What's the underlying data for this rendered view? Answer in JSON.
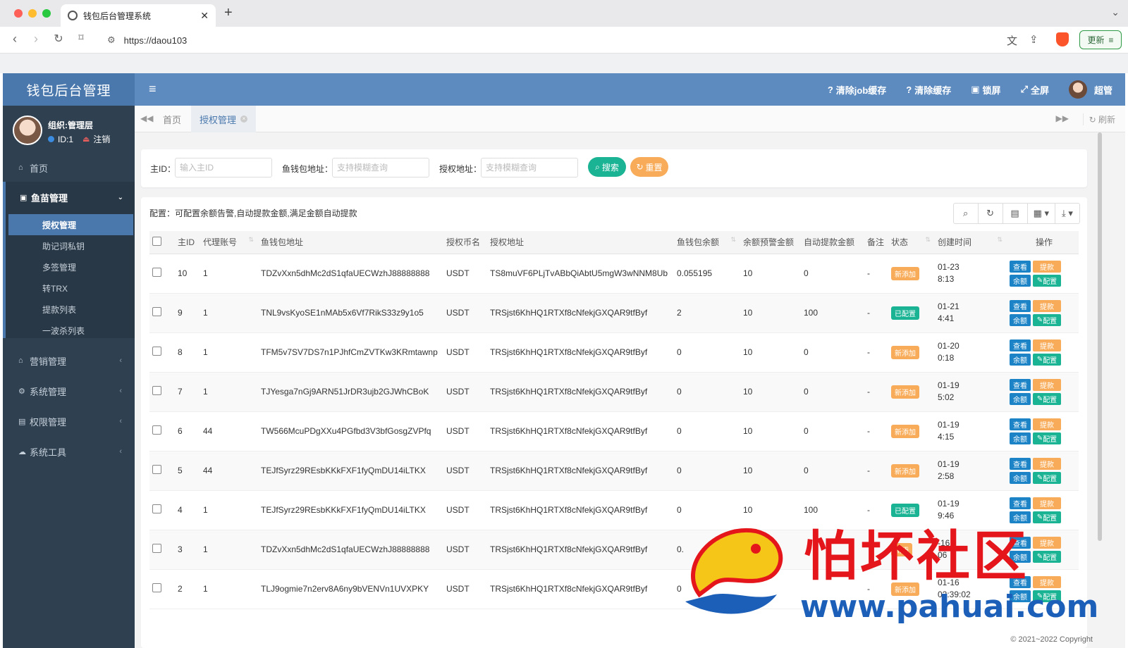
{
  "browser": {
    "tab_title": "钱包后台管理系统",
    "url": "https://daou103",
    "update_label": "更新"
  },
  "app": {
    "logo_text": "钱包后台管理",
    "header_items": [
      "清除job缓存",
      "清除缓存",
      "锁屏",
      "全屏"
    ],
    "username": "超管"
  },
  "user": {
    "org": "组织:管理层",
    "id": "ID:1",
    "logout": "注销"
  },
  "sidebar": {
    "home": "首页",
    "group": "鱼苗管理",
    "sub_items": [
      "授权管理",
      "助记词私钥",
      "多签管理",
      "转TRX",
      "提款列表",
      "一波杀列表"
    ],
    "items": [
      "营销管理",
      "系统管理",
      "权限管理",
      "系统工具"
    ]
  },
  "tabs": {
    "home": "首页",
    "active": "授权管理",
    "refresh": "刷新"
  },
  "search": {
    "main_id_label": "主ID：",
    "main_id_placeholder": "输入主ID",
    "fish_wallet_label": "鱼钱包地址：",
    "fish_wallet_placeholder": "支持模糊查询",
    "auth_addr_label": "授权地址：",
    "auth_addr_placeholder": "支持模糊查询",
    "search_btn": "搜索",
    "reset_btn": "重置"
  },
  "table": {
    "config_note": "配置：可配置余额告警,自动提款金额,满足金额自动提款",
    "headers": [
      "主ID",
      "代理账号",
      "鱼钱包地址",
      "授权币名",
      "授权地址",
      "鱼钱包余额",
      "余额预警金额",
      "自动提款金额",
      "备注",
      "状态",
      "创建时间",
      "操作"
    ],
    "ops": {
      "view": "查看",
      "withdraw": "提款",
      "balance": "余额",
      "config": "配置"
    },
    "rows": [
      {
        "id": "10",
        "agent": "1",
        "wallet": "TDZvXxn5dhMc2dS1qfaUECWzhJ88888888",
        "coin": "USDT",
        "auth": "TS8muVF6PLjTvABbQiAbtU5mgW3wNNM8Ub",
        "balance": "0.055195",
        "warn": "10",
        "auto": "0",
        "note": "-",
        "status": "新添加",
        "status_type": "new",
        "date": "01-23",
        "time": "8:13"
      },
      {
        "id": "9",
        "agent": "1",
        "wallet": "TNL9vsKyoSE1nMAb5x6Vf7RikS33z9y1o5",
        "coin": "USDT",
        "auth": "TRSjst6KhHQ1RTXf8cNfekjGXQAR9tfByf",
        "balance": "2",
        "warn": "10",
        "auto": "100",
        "note": "-",
        "status": "已配置",
        "status_type": "cfg",
        "date": "01-21",
        "time": "4:41"
      },
      {
        "id": "8",
        "agent": "1",
        "wallet": "TFM5v7SV7DS7n1PJhfCmZVTKw3KRmtawnp",
        "coin": "USDT",
        "auth": "TRSjst6KhHQ1RTXf8cNfekjGXQAR9tfByf",
        "balance": "0",
        "warn": "10",
        "auto": "0",
        "note": "-",
        "status": "新添加",
        "status_type": "new",
        "date": "01-20",
        "time": "0:18"
      },
      {
        "id": "7",
        "agent": "1",
        "wallet": "TJYesga7nGj9ARN51JrDR3ujb2GJWhCBoK",
        "coin": "USDT",
        "auth": "TRSjst6KhHQ1RTXf8cNfekjGXQAR9tfByf",
        "balance": "0",
        "warn": "10",
        "auto": "0",
        "note": "-",
        "status": "新添加",
        "status_type": "new",
        "date": "01-19",
        "time": "5:02"
      },
      {
        "id": "6",
        "agent": "44",
        "wallet": "TW566McuPDgXXu4PGfbd3V3bfGosgZVPfq",
        "coin": "USDT",
        "auth": "TRSjst6KhHQ1RTXf8cNfekjGXQAR9tfByf",
        "balance": "0",
        "warn": "10",
        "auto": "0",
        "note": "-",
        "status": "新添加",
        "status_type": "new",
        "date": "01-19",
        "time": "4:15"
      },
      {
        "id": "5",
        "agent": "44",
        "wallet": "TEJfSyrz29REsbKKkFXF1fyQmDU14iLTKX",
        "coin": "USDT",
        "auth": "TRSjst6KhHQ1RTXf8cNfekjGXQAR9tfByf",
        "balance": "0",
        "warn": "10",
        "auto": "0",
        "note": "-",
        "status": "新添加",
        "status_type": "new",
        "date": "01-19",
        "time": "2:58"
      },
      {
        "id": "4",
        "agent": "1",
        "wallet": "TEJfSyrz29REsbKKkFXF1fyQmDU14iLTKX",
        "coin": "USDT",
        "auth": "TRSjst6KhHQ1RTXf8cNfekjGXQAR9tfByf",
        "balance": "0",
        "warn": "10",
        "auto": "100",
        "note": "-",
        "status": "已配置",
        "status_type": "cfg",
        "date": "01-19",
        "time": "9:46"
      },
      {
        "id": "3",
        "agent": "1",
        "wallet": "TDZvXxn5dhMc2dS1qfaUECWzhJ88888888",
        "coin": "USDT",
        "auth": "TRSjst6KhHQ1RTXf8cNfekjGXQAR9tfByf",
        "balance": "0.",
        "warn": "",
        "auto": "",
        "note": "",
        "status": "新添",
        "status_type": "new",
        "date": "-16",
        "time": "06"
      },
      {
        "id": "2",
        "agent": "1",
        "wallet": "TLJ9ogmie7n2erv8A6ny9bVENVn1UVXPKY",
        "coin": "USDT",
        "auth": "TRSjst6KhHQ1RTXf8cNfekjGXQAR9tfByf",
        "balance": "0",
        "warn": "",
        "auto": "",
        "note": "-",
        "status": "新添加",
        "status_type": "new",
        "date": "01-16",
        "time": "02:39:02"
      }
    ]
  },
  "footer": {
    "copyright": "© 2021~2022 Copyright"
  },
  "watermark": {
    "title": "怕坏社区",
    "url": "www.pahuai.com"
  },
  "colors": {
    "header": "#5d8bc0",
    "sidebar": "#2f4050",
    "primary": "#1ab394",
    "warning": "#f8ac59",
    "info": "#1c84c6"
  }
}
